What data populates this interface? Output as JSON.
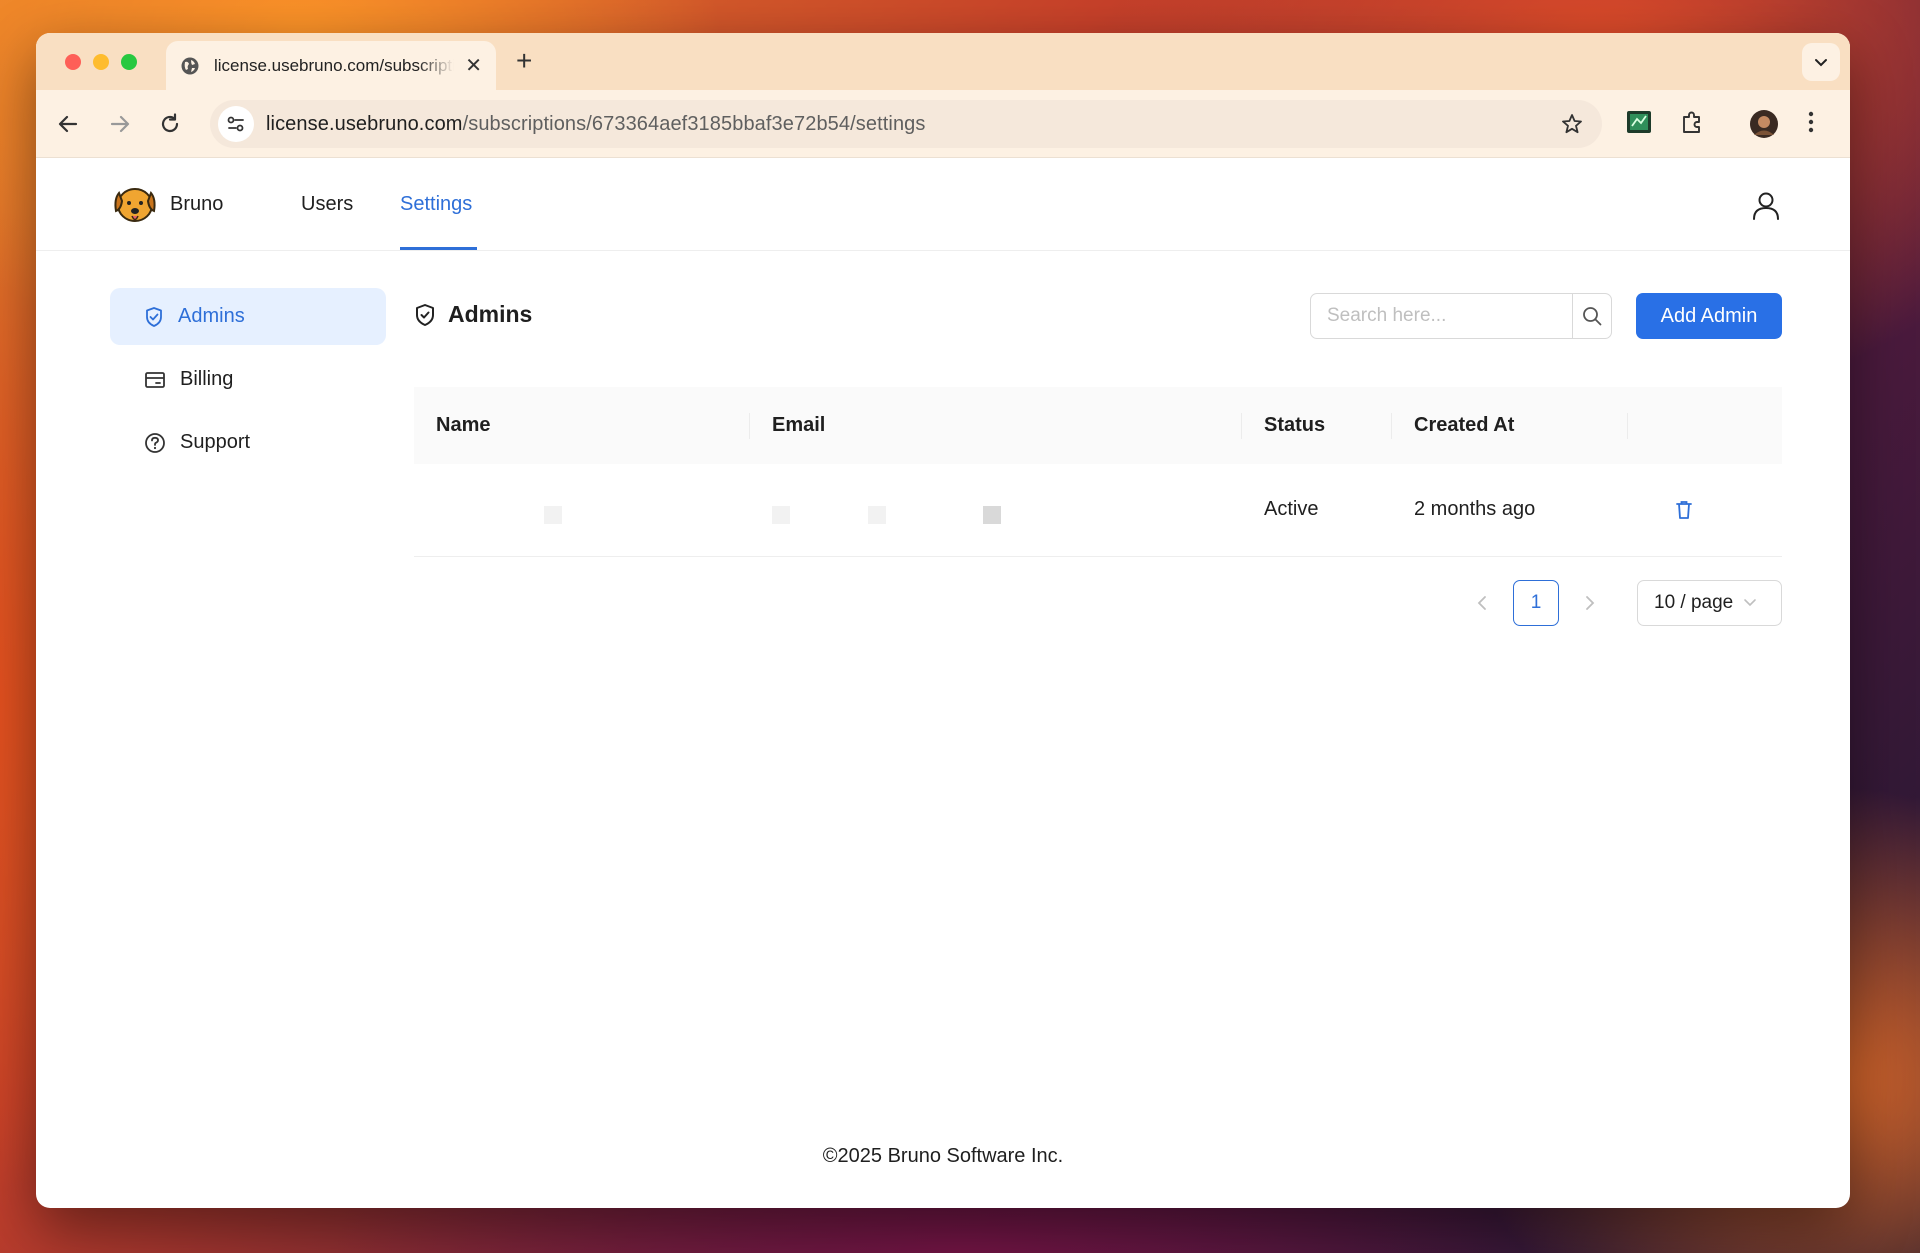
{
  "browser": {
    "tab_title": "license.usebruno.com/subscriptions/673364aef3185bbaf3e72b54/settings",
    "url_host": "license.usebruno.com",
    "url_path": "/subscriptions/673364aef3185bbaf3e72b54/settings",
    "new_tab_label": "+",
    "close_tab_label": "✕"
  },
  "header": {
    "brand": "Bruno",
    "nav": {
      "users": "Users",
      "settings": "Settings"
    },
    "active_nav": "Settings"
  },
  "sidebar": {
    "items": [
      {
        "label": "Admins",
        "icon": "shield-check-icon",
        "active": true
      },
      {
        "label": "Billing",
        "icon": "credit-card-icon",
        "active": false
      },
      {
        "label": "Support",
        "icon": "help-circle-icon",
        "active": false
      }
    ]
  },
  "main": {
    "title": "Admins",
    "search_placeholder": "Search here...",
    "add_button": "Add Admin",
    "table": {
      "columns": [
        "Name",
        "Email",
        "Status",
        "Created At"
      ],
      "rows": [
        {
          "name": "",
          "email": "",
          "status": "Active",
          "created_at": "2 months ago"
        }
      ]
    },
    "pagination": {
      "current_page": "1",
      "page_size": "10 / page"
    }
  },
  "footer": {
    "text": "©2025 Bruno Software Inc."
  },
  "colors": {
    "accent": "#2e6fd8",
    "primary_button": "#2970e6",
    "active_sidebar_bg": "#e6f0ff"
  }
}
